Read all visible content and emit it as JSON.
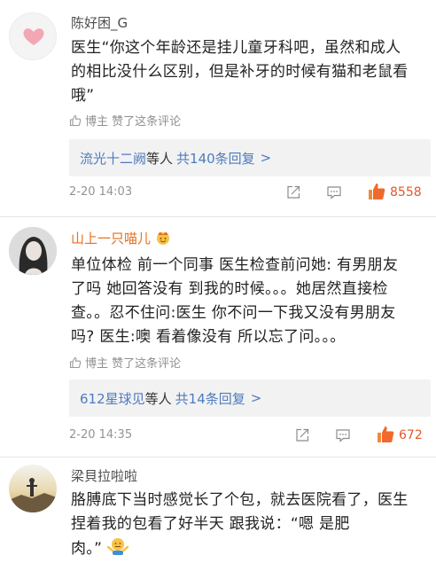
{
  "comments": [
    {
      "username": "陈好困_G",
      "name_color": "#4d4d4d",
      "lines": [
        "医生“你这个年龄还是挂儿童牙科吧，虽然和成人",
        "的相比没什么区别，但是补牙的时候有猫和老鼠看",
        "哦”"
      ],
      "author_liked_label": "博主 赞了这条评论",
      "reply_users": "流光十二阙",
      "reply_suffix": "等人",
      "reply_count": "共140条回复",
      "reply_arrow": ">",
      "timestamp": "2-20 14:03",
      "likes": "8558",
      "avatar_icon": "pink-heart-icon"
    },
    {
      "username": "山上一只喵儿",
      "name_color": "#e8701a",
      "badge_icon": "crown-face-emoji-icon",
      "lines": [
        "单位体检 前一个同事 医生检查前问她: 有男朋友",
        "了吗 她回答没有 到我的时候。。。她居然直接检",
        "查。。忍不住问:医生 你不问一下我又没有男朋友",
        "吗? 医生:噢 看着像没有 所以忘了问。。。"
      ],
      "author_liked_label": "博主 赞了这条评论",
      "reply_users": "612星球见",
      "reply_suffix": "等人",
      "reply_count": "共14条回复",
      "reply_arrow": ">",
      "timestamp": "2-20 14:35",
      "likes": "672",
      "avatar_icon": "portrait-photo-icon"
    },
    {
      "username": "梁貝拉啦啦",
      "name_color": "#4d4d4d",
      "lines": [
        "胳膊底下当时感觉长了个包，就去医院看了，医生",
        "捏着我的包看了好半天 跟我说：“嗯 是肥",
        "肉。”"
      ],
      "trailing_emoji_icon": "shrug-emoji-icon",
      "avatar_icon": "sunset-photo-icon"
    }
  ],
  "colors": {
    "link_blue": "#4e7bbf",
    "like_orange": "#e3572a",
    "meta_gray": "#939393",
    "reply_bg": "#f2f2f2"
  }
}
